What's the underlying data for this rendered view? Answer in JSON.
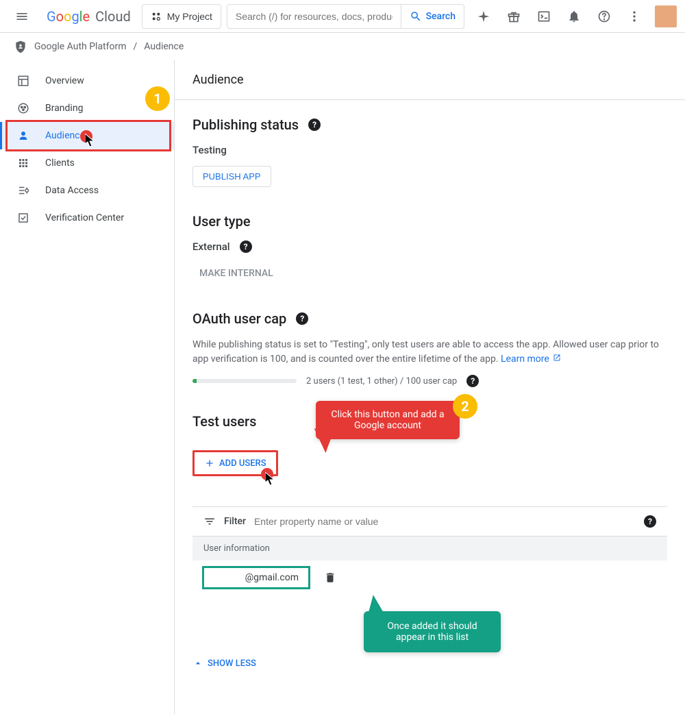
{
  "header": {
    "logo_cloud": "Cloud",
    "project_button": "My Project",
    "search_placeholder": "Search (/) for resources, docs, product...",
    "search_button": "Search"
  },
  "breadcrumb": {
    "root": "Google Auth Platform",
    "current": "Audience"
  },
  "sidebar": {
    "items": [
      {
        "label": "Overview"
      },
      {
        "label": "Branding"
      },
      {
        "label": "Audience"
      },
      {
        "label": "Clients"
      },
      {
        "label": "Data Access"
      },
      {
        "label": "Verification Center"
      }
    ]
  },
  "main": {
    "title": "Audience",
    "publishing": {
      "heading": "Publishing status",
      "status": "Testing",
      "button": "PUBLISH APP"
    },
    "user_type": {
      "heading": "User type",
      "value": "External",
      "button": "MAKE INTERNAL"
    },
    "oauth_cap": {
      "heading": "OAuth user cap",
      "desc": "While publishing status is set to \"Testing\", only test users are able to access the app. Allowed user cap prior to app verification is 100, and is counted over the entire lifetime of the app. ",
      "learn_more": "Learn more",
      "progress_text": "2 users (1 test, 1 other) / 100 user cap"
    },
    "test_users": {
      "heading": "Test users",
      "add_button": "ADD USERS",
      "filter_label": "Filter",
      "filter_placeholder": "Enter property name or value",
      "table_header": "User information",
      "rows": [
        {
          "email": "@gmail.com"
        }
      ],
      "show_less": "SHOW LESS"
    }
  },
  "annotations": {
    "badge_1": "1",
    "badge_2": "2",
    "callout_red": "Click this button and add a Google account",
    "callout_teal": "Once added it should appear in this list"
  }
}
